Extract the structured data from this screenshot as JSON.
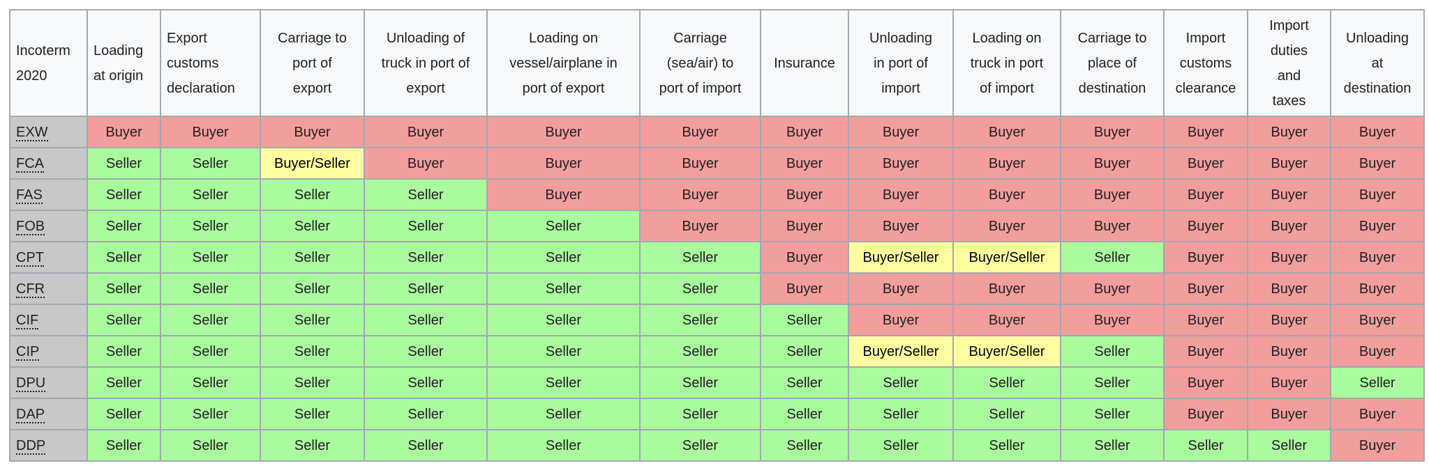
{
  "headers": [
    "Incoterm\n2020",
    "Loading\nat origin",
    "Export\ncustoms\ndeclaration",
    "Carriage to\nport of\nexport",
    "Unloading of\ntruck in port of\nexport",
    "Loading on\nvessel/airplane in\nport of export",
    "Carriage\n(sea/air) to\nport of import",
    "Insurance",
    "Unloading\nin port of\nimport",
    "Loading on\ntruck in port\nof import",
    "Carriage to\nplace of\ndestination",
    "Import\ncustoms\nclearance",
    "Import\nduties\nand\ntaxes",
    "Unloading\nat\ndestination"
  ],
  "colors": {
    "Buyer": "#f29e9c",
    "Seller": "#aafa9e",
    "Buyer/Seller": "#fefea0",
    "code_bg": "#c8c8c8",
    "header_bg": "#f8f9fa"
  },
  "rows": [
    {
      "code": "EXW",
      "values": [
        "Buyer",
        "Buyer",
        "Buyer",
        "Buyer",
        "Buyer",
        "Buyer",
        "Buyer",
        "Buyer",
        "Buyer",
        "Buyer",
        "Buyer",
        "Buyer",
        "Buyer"
      ]
    },
    {
      "code": "FCA",
      "values": [
        "Seller",
        "Seller",
        "Buyer/Seller",
        "Buyer",
        "Buyer",
        "Buyer",
        "Buyer",
        "Buyer",
        "Buyer",
        "Buyer",
        "Buyer",
        "Buyer",
        "Buyer"
      ]
    },
    {
      "code": "FAS",
      "values": [
        "Seller",
        "Seller",
        "Seller",
        "Seller",
        "Buyer",
        "Buyer",
        "Buyer",
        "Buyer",
        "Buyer",
        "Buyer",
        "Buyer",
        "Buyer",
        "Buyer"
      ]
    },
    {
      "code": "FOB",
      "values": [
        "Seller",
        "Seller",
        "Seller",
        "Seller",
        "Seller",
        "Buyer",
        "Buyer",
        "Buyer",
        "Buyer",
        "Buyer",
        "Buyer",
        "Buyer",
        "Buyer"
      ]
    },
    {
      "code": "CPT",
      "values": [
        "Seller",
        "Seller",
        "Seller",
        "Seller",
        "Seller",
        "Seller",
        "Buyer",
        "Buyer/Seller",
        "Buyer/Seller",
        "Seller",
        "Buyer",
        "Buyer",
        "Buyer"
      ]
    },
    {
      "code": "CFR",
      "values": [
        "Seller",
        "Seller",
        "Seller",
        "Seller",
        "Seller",
        "Seller",
        "Buyer",
        "Buyer",
        "Buyer",
        "Buyer",
        "Buyer",
        "Buyer",
        "Buyer"
      ]
    },
    {
      "code": "CIF",
      "values": [
        "Seller",
        "Seller",
        "Seller",
        "Seller",
        "Seller",
        "Seller",
        "Seller",
        "Buyer",
        "Buyer",
        "Buyer",
        "Buyer",
        "Buyer",
        "Buyer"
      ]
    },
    {
      "code": "CIP",
      "values": [
        "Seller",
        "Seller",
        "Seller",
        "Seller",
        "Seller",
        "Seller",
        "Seller",
        "Buyer/Seller",
        "Buyer/Seller",
        "Seller",
        "Buyer",
        "Buyer",
        "Buyer"
      ]
    },
    {
      "code": "DPU",
      "values": [
        "Seller",
        "Seller",
        "Seller",
        "Seller",
        "Seller",
        "Seller",
        "Seller",
        "Seller",
        "Seller",
        "Seller",
        "Buyer",
        "Buyer",
        "Seller"
      ]
    },
    {
      "code": "DAP",
      "values": [
        "Seller",
        "Seller",
        "Seller",
        "Seller",
        "Seller",
        "Seller",
        "Seller",
        "Seller",
        "Seller",
        "Seller",
        "Buyer",
        "Buyer",
        "Buyer"
      ]
    },
    {
      "code": "DDP",
      "values": [
        "Seller",
        "Seller",
        "Seller",
        "Seller",
        "Seller",
        "Seller",
        "Seller",
        "Seller",
        "Seller",
        "Seller",
        "Seller",
        "Seller",
        "Buyer"
      ]
    }
  ]
}
